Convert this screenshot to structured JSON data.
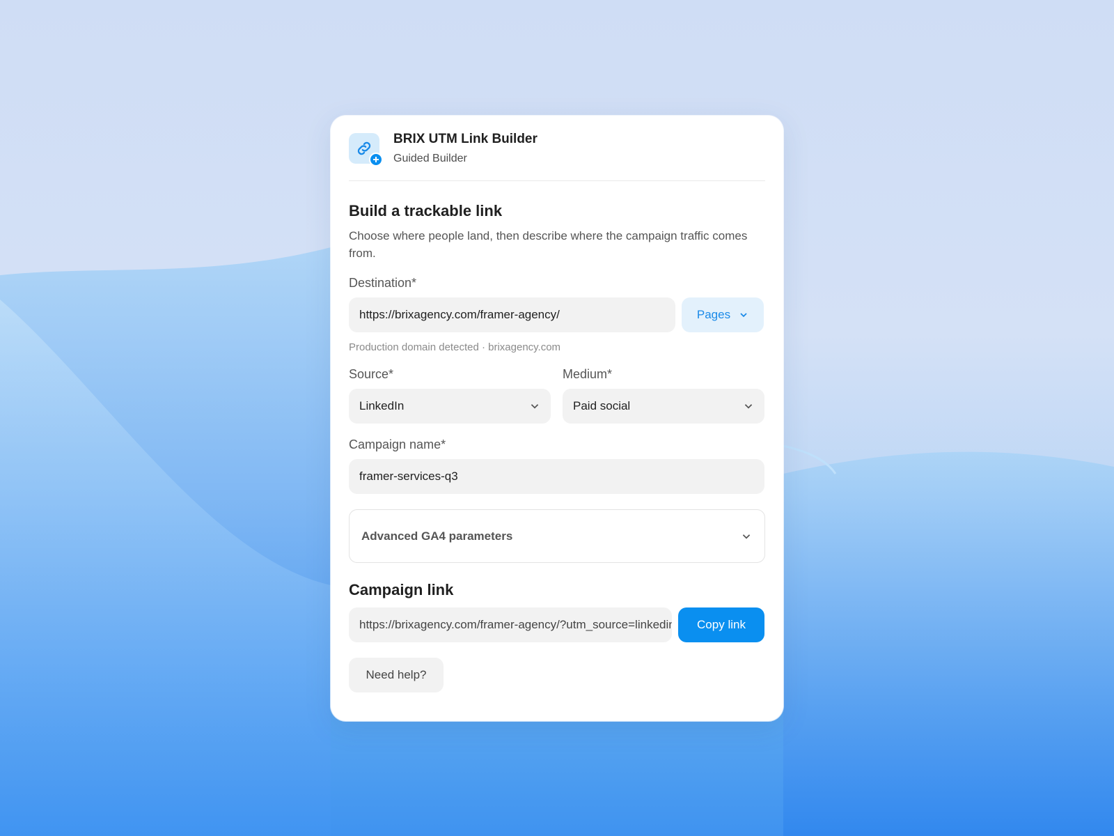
{
  "app": {
    "title": "BRIX UTM Link Builder",
    "subtitle": "Guided Builder",
    "icon": "link-icon",
    "accent": "#0a8ff0"
  },
  "form": {
    "heading": "Build a trackable link",
    "description": "Choose where people land, then describe where the campaign traffic comes from.",
    "destination": {
      "label": "Destination*",
      "value": "https://brixagency.com/framer-agency/",
      "pages_button": "Pages",
      "hint": "Production domain detected · brixagency.com"
    },
    "source": {
      "label": "Source*",
      "value": "LinkedIn"
    },
    "medium": {
      "label": "Medium*",
      "value": "Paid social"
    },
    "campaign_name": {
      "label": "Campaign name*",
      "value": "framer-services-q3"
    },
    "advanced": {
      "label": "Advanced GA4 parameters"
    }
  },
  "result": {
    "heading": "Campaign link",
    "value": "https://brixagency.com/framer-agency/?utm_source=linkedin",
    "copy_button": "Copy link"
  },
  "help_button": "Need help?"
}
